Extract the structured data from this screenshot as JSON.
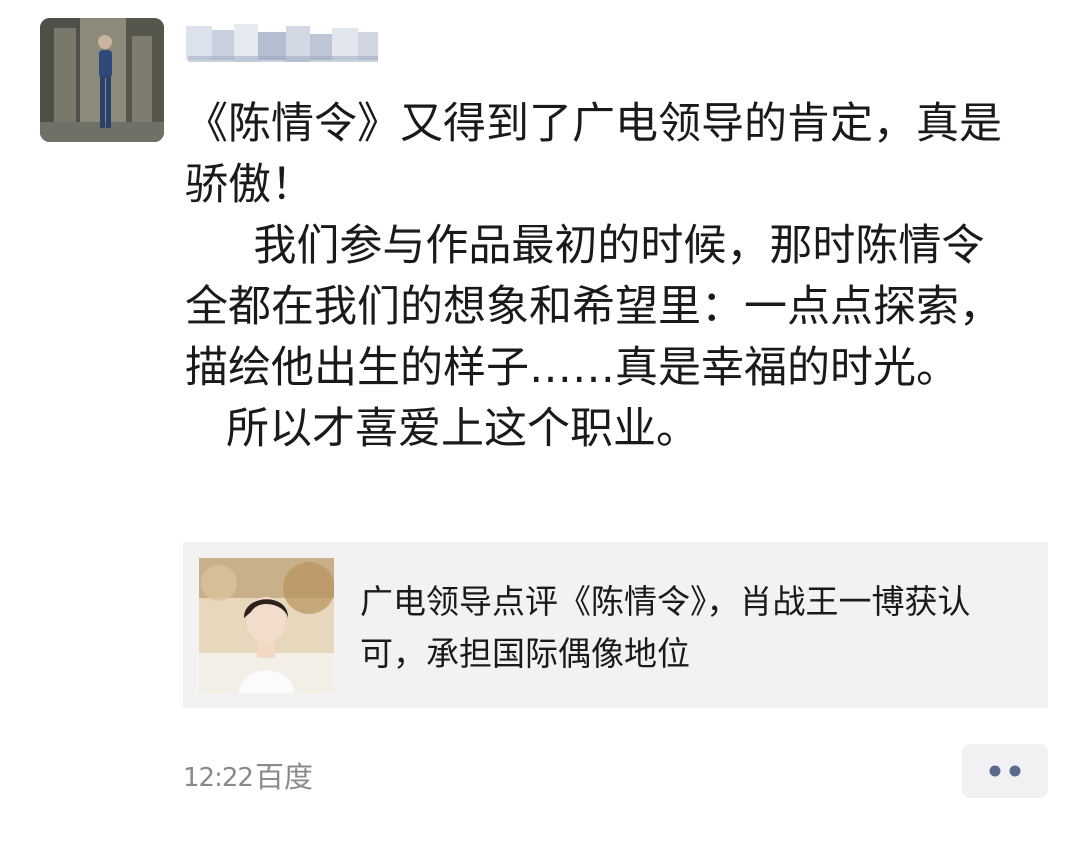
{
  "post": {
    "author_name": "",
    "text": "《陈情令》又得到了广电领导的肯定，真是骄傲！\n     我们参与作品最初的时候，那时陈情令全都在我们的想象和希望里：一点点探索，描绘他出生的样子……真是幸福的时光。\n   所以才喜爱上这个职业。",
    "link_card": {
      "title": "广电领导点评《陈情令》，肖战王一博获认可，承担国际偶像地位",
      "background": "#f2f2f2"
    },
    "footer": {
      "time": "12:22",
      "source": "百度"
    }
  },
  "icons": {
    "more": "more-dots-icon"
  },
  "colors": {
    "text": "#1a1a1a",
    "meta": "#8a8a8a",
    "accent_dots": "#5a6a8c"
  }
}
